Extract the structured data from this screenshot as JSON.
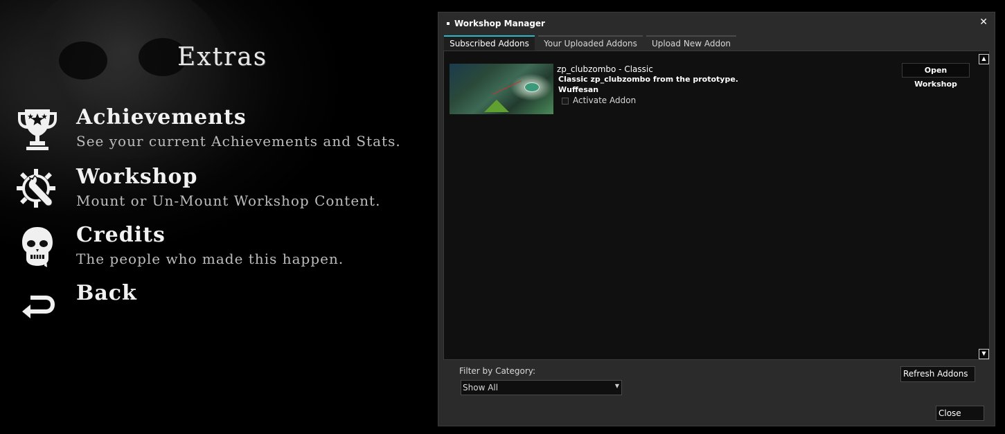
{
  "extras": {
    "title": "Extras",
    "items": [
      {
        "label": "Achievements",
        "desc": "See your current Achievements and Stats.",
        "icon": "trophy-icon"
      },
      {
        "label": "Workshop",
        "desc": "Mount or Un-Mount Workshop Content.",
        "icon": "gear-wrench-icon"
      },
      {
        "label": "Credits",
        "desc": "The people who made this happen.",
        "icon": "zombie-head-icon"
      },
      {
        "label": "Back",
        "desc": "",
        "icon": "back-arrow-icon"
      }
    ]
  },
  "window": {
    "title": "Workshop Manager",
    "close_glyph": "✕",
    "tabs": [
      {
        "label": "Subscribed Addons",
        "active": true
      },
      {
        "label": "Your Uploaded Addons",
        "active": false
      },
      {
        "label": "Upload New Addon",
        "active": false
      }
    ],
    "addon": {
      "name": "zp_clubzombo - Classic",
      "description": "Classic zp_clubzombo from the prototype.",
      "author": "Wuffesan",
      "activate_label": "Activate Addon",
      "activated": false,
      "open_button": "Open Workshop"
    },
    "scroll_up_glyph": "▲",
    "scroll_down_glyph": "▼",
    "filter": {
      "label": "Filter by Category:",
      "selected": "Show All",
      "arrow_glyph": "▼"
    },
    "refresh_button": "Refresh Addons",
    "close_button": "Close"
  },
  "colors": {
    "active_tab_accent": "#2fb8c8",
    "window_bg": "#2b2b2b",
    "content_bg": "#101010"
  }
}
